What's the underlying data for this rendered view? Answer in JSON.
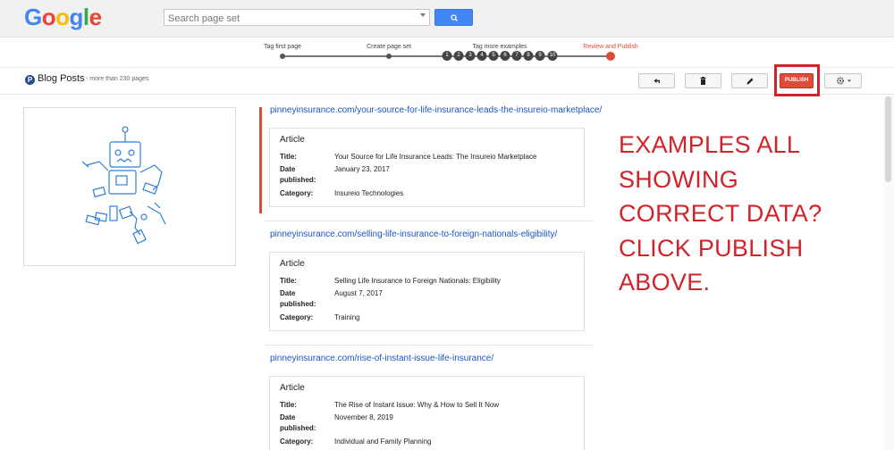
{
  "header": {
    "logo_letters": [
      {
        "ch": "G",
        "color": "#4285f4"
      },
      {
        "ch": "o",
        "color": "#ea4335"
      },
      {
        "ch": "o",
        "color": "#fbbc05"
      },
      {
        "ch": "g",
        "color": "#4285f4"
      },
      {
        "ch": "l",
        "color": "#34a853"
      },
      {
        "ch": "e",
        "color": "#ea4335"
      }
    ],
    "search_placeholder": "Search page set",
    "search_icon": "search-icon"
  },
  "stepper": {
    "steps": [
      "Tag first page",
      "Create page set",
      "Tag more examples",
      "Review and Publish"
    ],
    "active_step": "Review and Publish",
    "example_numbers": [
      "1",
      "2",
      "3",
      "4",
      "5",
      "6",
      "7",
      "8",
      "9",
      "10"
    ]
  },
  "list": {
    "title": "Blog Posts",
    "count": "more than 230 pages",
    "buttons": {
      "undo_icon": "undo-arrow-icon",
      "delete_icon": "trash-icon",
      "edit_icon": "pencil-icon",
      "publish_label": "PUBLISH",
      "settings_icon": "gear-icon"
    }
  },
  "results": [
    {
      "url": "pinneyinsurance.com/your-source-for-life-insurance-leads-the-insureio-marketplace/",
      "type": "Article",
      "title_label": "Title:",
      "title": "Your Source for Life Insurance Leads: The Insureio Marketplace",
      "date_label_1": "Date",
      "date_label_2": "published:",
      "date": "January 23, 2017",
      "category_label": "Category:",
      "category": "Insureio Technologies"
    },
    {
      "url": "pinneyinsurance.com/selling-life-insurance-to-foreign-nationals-eligibility/",
      "type": "Article",
      "title_label": "Title:",
      "title": "Selling Life Insurance to Foreign Nationals: Eligibility",
      "date_label_1": "Date",
      "date_label_2": "published:",
      "date": "August 7, 2017",
      "category_label": "Category:",
      "category": "Training"
    },
    {
      "url": "pinneyinsurance.com/rise-of-instant-issue-life-insurance/",
      "type": "Article",
      "title_label": "Title:",
      "title": "The Rise of Instant Issue: Why & How to Sell It Now",
      "date_label_1": "Date",
      "date_label_2": "published:",
      "date": "November 8, 2019",
      "category_label": "Category:",
      "category": "Individual and Family Planning"
    }
  ],
  "callout": {
    "lines": [
      "EXAMPLES ALL",
      "SHOWING",
      "CORRECT DATA?",
      "CLICK PUBLISH",
      "ABOVE."
    ],
    "color": "#d2232a"
  },
  "colors": {
    "accent_red": "#dd4b39",
    "link_blue": "#1a55c0",
    "search_button_blue": "#4285f4"
  }
}
